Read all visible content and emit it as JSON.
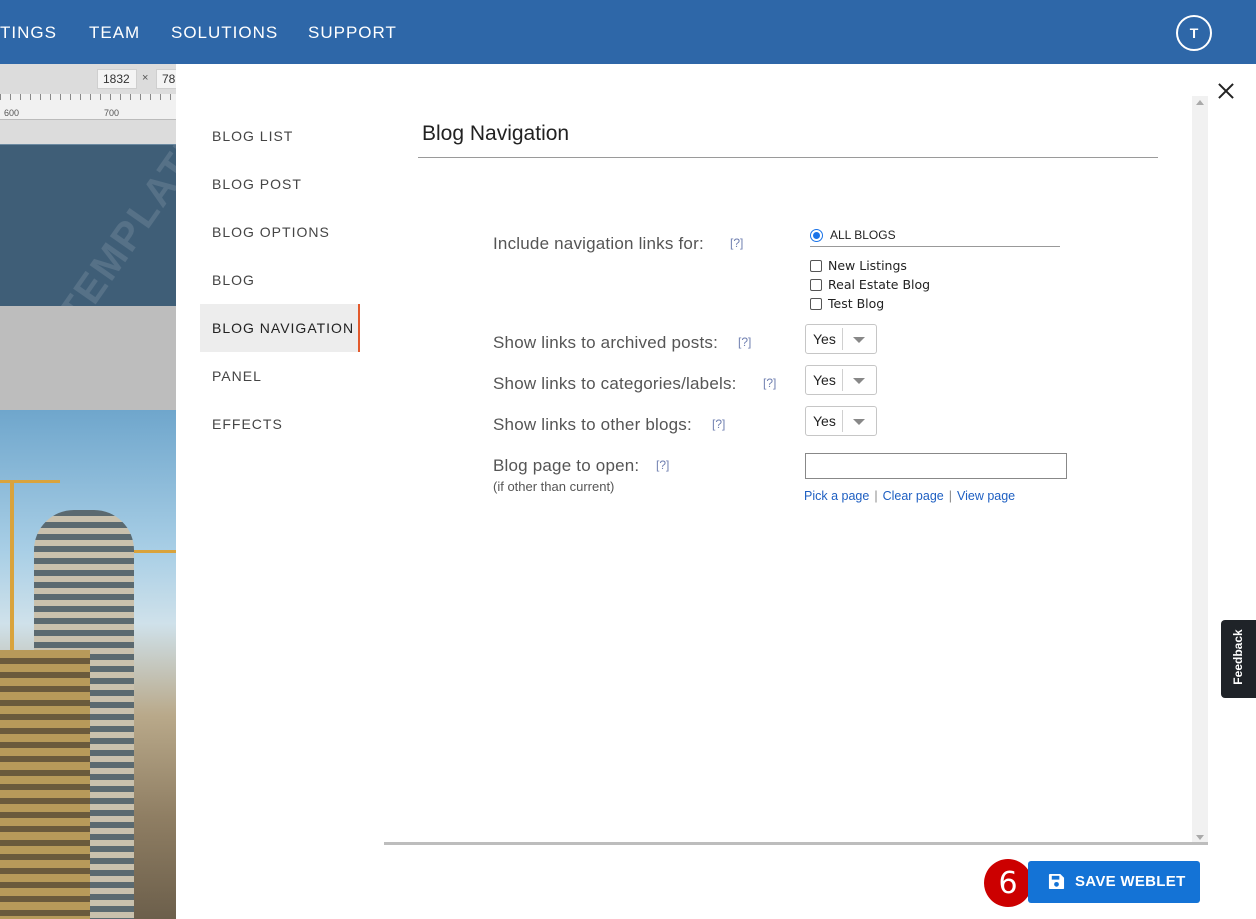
{
  "topnav": {
    "items": [
      "TINGS",
      "TEAM",
      "SOLUTIONS",
      "SUPPORT"
    ],
    "avatar_initial": "T"
  },
  "editor_bg": {
    "width_value": "1832",
    "times": "×",
    "height_value": "78",
    "ruler_labels": [
      "600",
      "700"
    ],
    "watermark": "TEMPLATE"
  },
  "side_menu": {
    "items": [
      "BLOG LIST",
      "BLOG POST",
      "BLOG OPTIONS",
      "BLOG",
      "BLOG NAVIGATION",
      "PANEL",
      "EFFECTS"
    ],
    "active": "BLOG NAVIGATION"
  },
  "panel": {
    "title": "Blog Navigation",
    "help_marker": "[?]",
    "include_label": "Include navigation links for:",
    "radio_all_label": "ALL BLOGS",
    "blogs": [
      "New Listings",
      "Real Estate Blog",
      "Test Blog"
    ],
    "archived_label": "Show links to archived posts:",
    "archived_value": "Yes",
    "categories_label": "Show links to categories/labels:",
    "categories_value": "Yes",
    "other_blogs_label": "Show links to other blogs:",
    "other_blogs_value": "Yes",
    "page_open_label": "Blog page to open:",
    "page_open_sublabel": "(if other than current)",
    "page_open_value": "",
    "pick_page": "Pick a page",
    "clear_page": "Clear page",
    "view_page": "View page",
    "link_sep": "|"
  },
  "footer": {
    "step_number": "6",
    "save_label": "SAVE WEBLET"
  },
  "feedback_label": "Feedback",
  "colors": {
    "nav_bg": "#2e67a8",
    "accent_active": "#e35a2c",
    "save_button": "#1473d6",
    "step_badge": "#cc0000",
    "link": "#1e5fc2"
  }
}
